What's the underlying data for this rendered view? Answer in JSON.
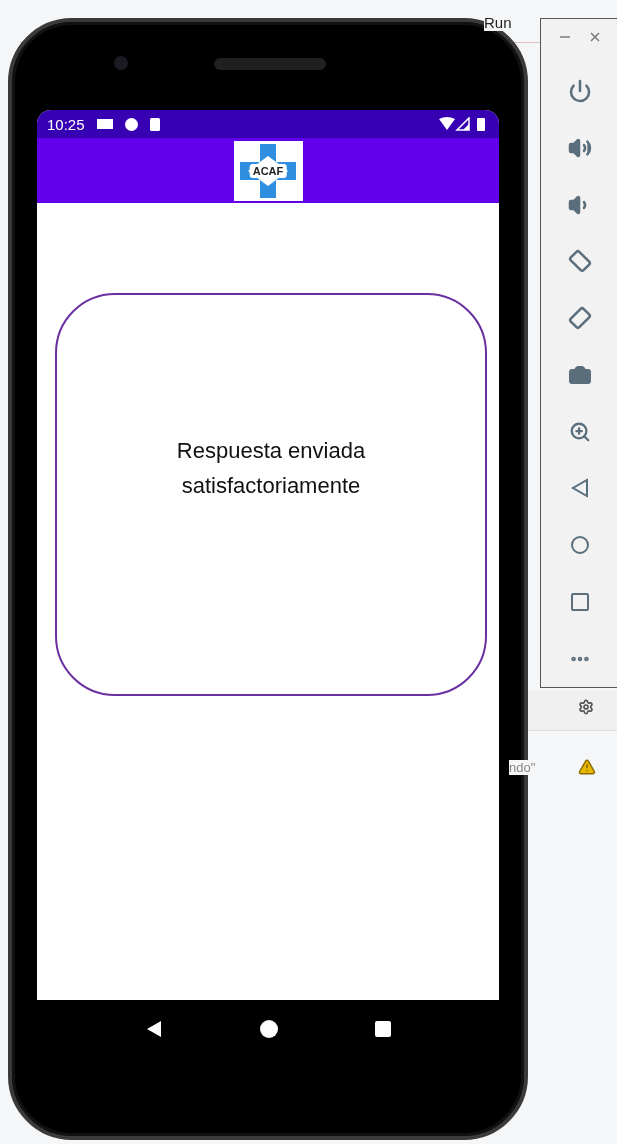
{
  "ide": {
    "menu_item": "Run",
    "log_text": "ndo\""
  },
  "status_bar": {
    "time": "10:25"
  },
  "app_bar": {
    "logo_text": "ACAF"
  },
  "card": {
    "message": "Respuesta enviada satisfactoriamente"
  }
}
